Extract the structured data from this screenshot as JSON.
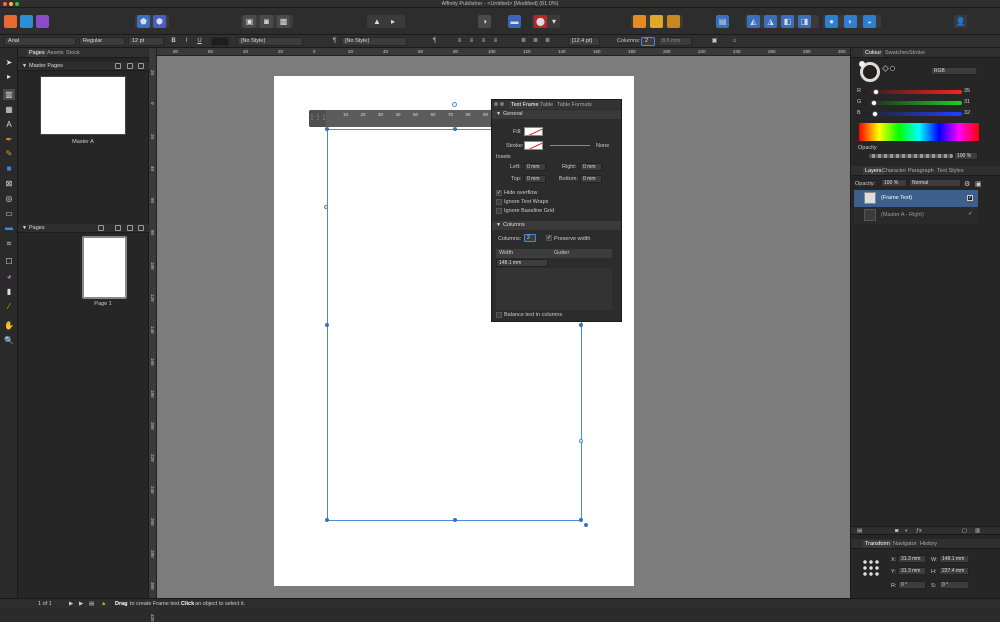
{
  "window": {
    "title": "Affinity Publisher - <Untitled> [Modified] (81.0%)"
  },
  "context": {
    "font": "Arial",
    "weight": "Regular",
    "size": "12 pt",
    "para_style": "[No Style]",
    "char_style": "[No Style]",
    "leading": "[12.4 pt]",
    "columns_label": "Columns:",
    "columns_value": "2",
    "gutter": "8.5 mm"
  },
  "left_panel": {
    "tabs": [
      "Pages",
      "Assets",
      "Stock"
    ],
    "master_section": "Master Pages",
    "master_name": "Master A",
    "pages_section": "Pages",
    "page_name": "Page 1"
  },
  "hruler": [
    "80",
    "60",
    "40",
    "20",
    "0",
    "20",
    "40",
    "60",
    "80",
    "100",
    "120",
    "140",
    "160",
    "180",
    "200",
    "220",
    "240",
    "260",
    "280",
    "300",
    "320",
    "340"
  ],
  "vruler": [
    "20",
    "0",
    "20",
    "40",
    "60",
    "80",
    "100",
    "120",
    "140",
    "160",
    "180",
    "200",
    "220",
    "240",
    "260",
    "280",
    "300",
    "320"
  ],
  "frame_ruler": [
    "10",
    "20",
    "30",
    "40",
    "50",
    "60",
    "70",
    "80",
    "90",
    "100",
    "110",
    "120",
    "130",
    "140"
  ],
  "frame_ruler_grip": "⋮⋮⋮",
  "text_frame_panel": {
    "tabs": [
      "Text Frame",
      "Table",
      "Table Formats"
    ],
    "general": "General",
    "fill_label": "Fill:",
    "stroke_label": "Stroke:",
    "stroke_value": "None",
    "insets_label": "Insets",
    "left_label": "Left:",
    "left_value": "0 mm",
    "right_label": "Right:",
    "right_value": "0 mm",
    "top_label": "Top:",
    "top_value": "0 mm",
    "bottom_label": "Bottom:",
    "bottom_value": "0 mm",
    "hide_overflow": "Hide overflow",
    "ignore_wraps": "Ignore Text Wraps",
    "ignore_grid": "Ignore Baseline Grid",
    "columns_section": "Columns",
    "columns_label": "Columns:",
    "columns_value": "2",
    "preserve_width": "Preserve width",
    "width_header": "Width",
    "gutter_header": "Gutter",
    "width_value": "148.1 mm",
    "balance": "Balance text in columns"
  },
  "right_panel": {
    "color_tabs": [
      "Colour",
      "Swatches",
      "Stroke"
    ],
    "color_model": "RGB",
    "r_label": "R",
    "g_label": "G",
    "b_label": "B",
    "r_value": "35",
    "g_value": "31",
    "b_value": "32",
    "r_level": 0.14,
    "g_level": 0.12,
    "b_level": 0.13,
    "opacity_label": "Opacity",
    "opacity_value": "100 %",
    "layer_tabs": [
      "Layers",
      "Character",
      "Paragraph",
      "Text Styles"
    ],
    "layer_opacity_label": "Opacity:",
    "layer_opacity_value": "100 %",
    "blend_mode": "Normal",
    "layers": [
      {
        "name": "(Frame Text)",
        "selected": true
      },
      {
        "name": "(Master A - Right)",
        "selected": false
      }
    ],
    "transform_tabs": [
      "Transform",
      "Navigator",
      "History"
    ],
    "x_label": "X:",
    "x_value": "31.3 mm",
    "y_label": "Y:",
    "y_value": "31.3 mm",
    "w_label": "W:",
    "w_value": "148.1 mm",
    "h_label": "H:",
    "h_value": "227.4 mm",
    "r_rot_label": "R:",
    "r_rot_value": "0 °",
    "s_label": "S:",
    "s_value": "0 °"
  },
  "status": {
    "page_indicator": "1 of 1",
    "hint_drag": "Drag",
    "hint_text1": "to create Frame text.",
    "hint_click": "Click",
    "hint_text2": "an object to select it."
  }
}
